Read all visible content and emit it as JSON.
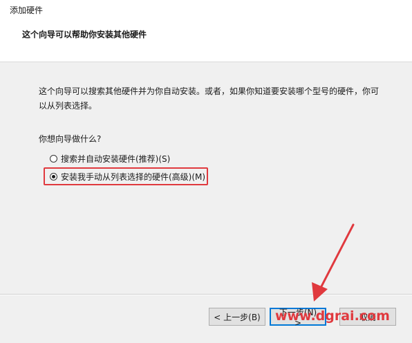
{
  "window": {
    "title": "添加硬件"
  },
  "header": {
    "title": "这个向导可以帮助你安装其他硬件"
  },
  "content": {
    "description": "这个向导可以搜索其他硬件并为你自动安装。或者，如果你知道要安装哪个型号的硬件，你可以从列表选择。",
    "question": "你想向导做什么?",
    "options": [
      {
        "label": "搜索并自动安装硬件(推荐)(S)",
        "checked": false
      },
      {
        "label": "安装我手动从列表选择的硬件(高级)(M)",
        "checked": true
      }
    ]
  },
  "buttons": {
    "back": "< 上一步(B)",
    "next": "下一步(N) >",
    "cancel": "取消"
  },
  "watermark": "www.dgrai.com",
  "colors": {
    "highlight": "#e0393e",
    "focus_border": "#0078d7",
    "arrow": "#e0393e"
  }
}
